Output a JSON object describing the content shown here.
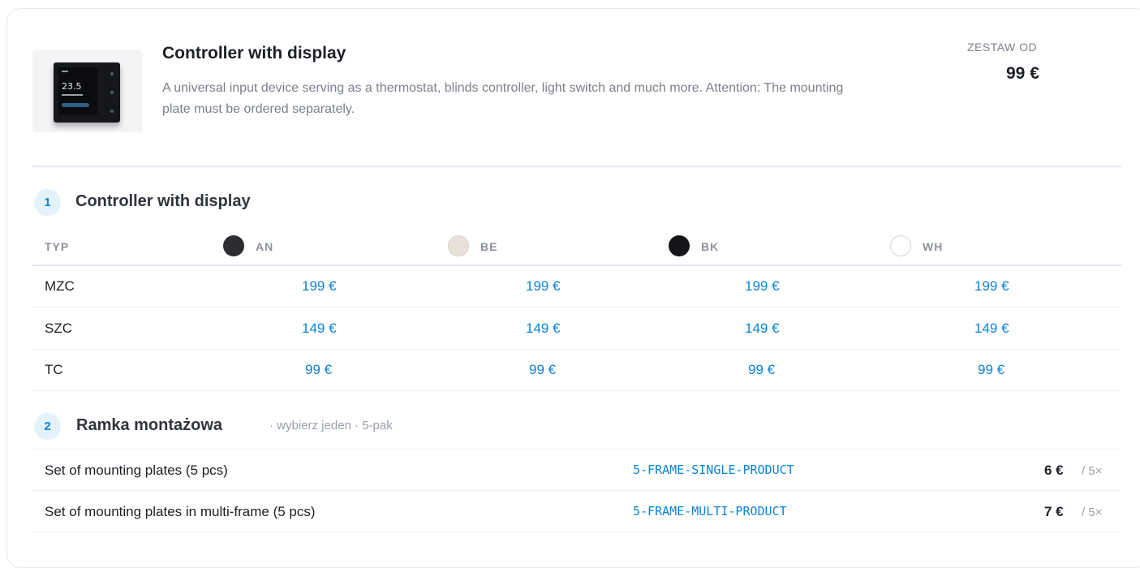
{
  "product": {
    "title": "Controller with display",
    "description": "A universal input device serving as a thermostat, blinds controller, light switch and much more. Attention: The mounting plate must be ordered separately.",
    "from_label": "ZESTAW OD",
    "from_price": "99 €",
    "thumbnail_temp": "23.5"
  },
  "section1": {
    "number": "1",
    "title": "Controller with display",
    "type_header": "TYP",
    "colors": [
      {
        "code": "AN",
        "swatch": "#2b2d31"
      },
      {
        "code": "BE",
        "swatch": "#e7e1da"
      },
      {
        "code": "BK",
        "swatch": "#141518"
      },
      {
        "code": "WH",
        "swatch": "#ffffff"
      }
    ],
    "rows": [
      {
        "type": "MZC",
        "prices": [
          "199 €",
          "199 €",
          "199 €",
          "199 €"
        ]
      },
      {
        "type": "SZC",
        "prices": [
          "149 €",
          "149 €",
          "149 €",
          "149 €"
        ]
      },
      {
        "type": "TC",
        "prices": [
          "99 €",
          "99 €",
          "99 €",
          "99 €"
        ]
      }
    ]
  },
  "section2": {
    "number": "2",
    "title": "Ramka montażowa",
    "subtitle": "· wybierz jeden · 5-pak",
    "items": [
      {
        "name": "Set of mounting plates (5 pcs)",
        "sku": "5-FRAME-SINGLE-PRODUCT",
        "price": "6 €",
        "qty": "/ 5×"
      },
      {
        "name": "Set of mounting plates in multi-frame (5 pcs)",
        "sku": "5-FRAME-MULTI-PRODUCT",
        "price": "7 €",
        "qty": "/ 5×"
      }
    ]
  },
  "colors": {
    "accent": "#0a84d8",
    "badge_bg": "#e4f2fc",
    "muted_text": "#7b818c"
  }
}
